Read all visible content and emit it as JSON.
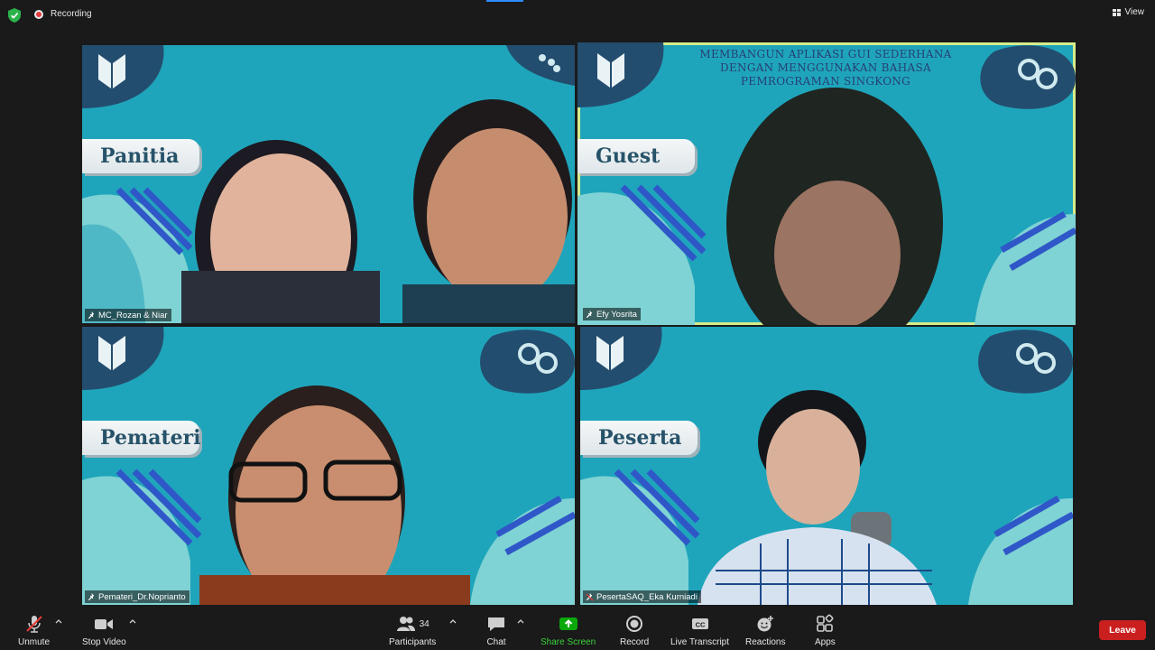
{
  "top": {
    "recording_label": "Recording",
    "view_label": "View"
  },
  "tiles": [
    {
      "role_tag": "Panitia",
      "name": "MC_Rozan & Niar"
    },
    {
      "role_tag": "Guest",
      "name": "Efy Yosrita",
      "banner": [
        "MEMBANGUN APLIKASI GUI SEDERHANA",
        "DENGAN MENGGUNAKAN BAHASA",
        "PEMROGRAMAN SINGKONG"
      ]
    },
    {
      "role_tag": "Pemateri",
      "name": "Pemateri_Dr.Noprianto"
    },
    {
      "role_tag": "Peserta",
      "name": "PesertaSAQ_Eka Kurniadi"
    }
  ],
  "toolbar": {
    "unmute": "Unmute",
    "stop_video": "Stop Video",
    "participants": "Participants",
    "participants_count": "34",
    "chat": "Chat",
    "share_screen": "Share Screen",
    "record": "Record",
    "live_transcript": "Live Transcript",
    "reactions": "Reactions",
    "apps": "Apps",
    "leave": "Leave"
  },
  "colors": {
    "accent": "#2d8cff",
    "share_green": "#0aa80a",
    "leave_red": "#c9201f",
    "active_speaker": "#d6ec8a",
    "tile_bg": "#1fa5bb"
  }
}
